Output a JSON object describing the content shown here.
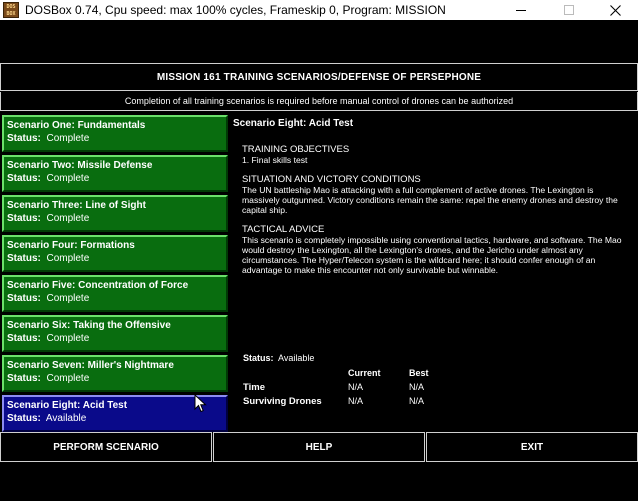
{
  "window": {
    "title": "DOSBox 0.74, Cpu speed: max 100% cycles, Frameskip  0, Program:  MISSION",
    "icon_label": "DOS BOX"
  },
  "header": {
    "title": "MISSION 161 TRAINING SCENARIOS/DEFENSE OF PERSEPHONE",
    "notice": "Completion of all training scenarios is required before manual control of drones can be authorized"
  },
  "scenarios": [
    {
      "name": "Scenario One: Fundamentals",
      "status_label": "Status:",
      "status": "Complete"
    },
    {
      "name": "Scenario Two: Missile Defense",
      "status_label": "Status:",
      "status": "Complete"
    },
    {
      "name": "Scenario Three: Line of Sight",
      "status_label": "Status:",
      "status": "Complete"
    },
    {
      "name": "Scenario Four: Formations",
      "status_label": "Status:",
      "status": "Complete"
    },
    {
      "name": "Scenario Five: Concentration of Force",
      "status_label": "Status:",
      "status": "Complete"
    },
    {
      "name": "Scenario Six: Taking the Offensive",
      "status_label": "Status:",
      "status": "Complete"
    },
    {
      "name": "Scenario Seven: Miller's Nightmare",
      "status_label": "Status:",
      "status": "Complete"
    },
    {
      "name": "Scenario Eight: Acid Test",
      "status_label": "Status:",
      "status": "Available"
    }
  ],
  "detail": {
    "title": "Scenario Eight: Acid Test",
    "objectives_head": "TRAINING OBJECTIVES",
    "objectives_body": "1. Final skills test",
    "conditions_head": "SITUATION AND VICTORY CONDITIONS",
    "conditions_body": "The UN battleship Mao is attacking with a full complement of active drones. The Lexington is massively outgunned. Victory conditions remain the same: repel the enemy drones and destroy the capital ship.",
    "advice_head": "TACTICAL ADVICE",
    "advice_body": "This scenario is completely impossible using conventional tactics, hardware, and software. The Mao would destroy the Lexington, all the Lexington's drones, and the Jericho under almost any circumstances. The Hyper/Telecon system is the wildcard here; it should confer enough of an advantage to make this encounter not only survivable but winnable.",
    "status_label": "Status:",
    "status": "Available",
    "col_current": "Current",
    "col_best": "Best",
    "rows": [
      {
        "label": "Time",
        "current": "N/A",
        "best": "N/A"
      },
      {
        "label": "Surviving Drones",
        "current": "N/A",
        "best": "N/A"
      }
    ]
  },
  "buttons": {
    "perform": "PERFORM SCENARIO",
    "help": "HELP",
    "exit": "EXIT"
  },
  "colors": {
    "scenario_bg": "#096d0f",
    "selected_bg": "#0a0a8a"
  }
}
